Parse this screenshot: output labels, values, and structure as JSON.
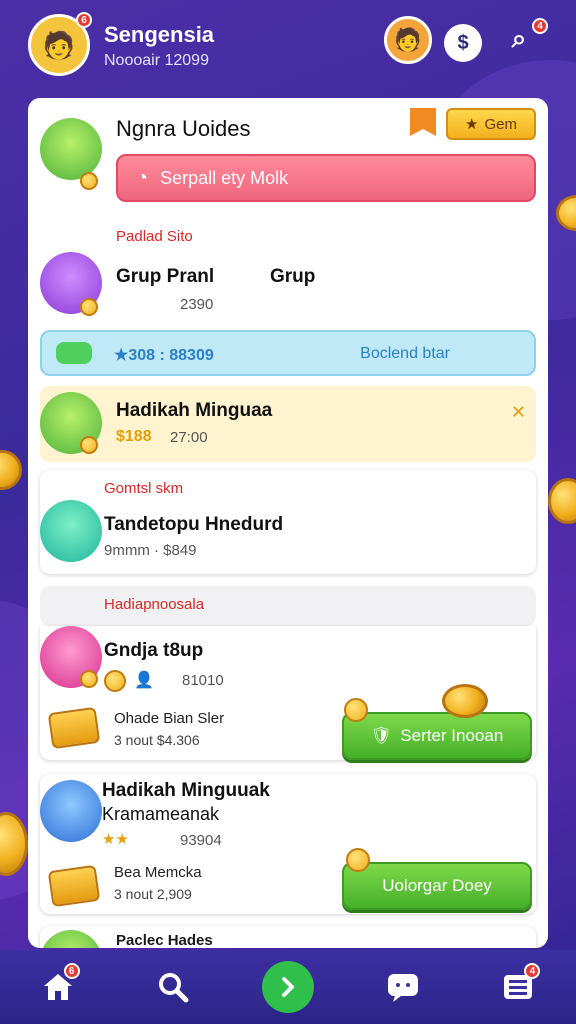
{
  "header": {
    "user_name": "Sengensia",
    "user_sub": "Noooair 12099",
    "avatar_badge": "6",
    "icons": [
      "friend-avatar-icon",
      "dollar-icon",
      "search-user-icon"
    ],
    "search_badge": "4"
  },
  "top_card": {
    "title": "Ngnra Uoides",
    "gem_label": "Gem",
    "search_text": "Serpall ety Molk"
  },
  "section1": {
    "label": "Padlad Sito",
    "title_a": "Grup Pranl",
    "title_b": "Grup",
    "sub": "2390"
  },
  "info_bar": {
    "left": "★308 : 88309",
    "right": "Boclend btar"
  },
  "highlight_row": {
    "title": "Hadikah Minguaa",
    "value": "$188",
    "sub": "27:00"
  },
  "section2": {
    "label": "Gomtsl skm",
    "title": "Tandetopu Hnedurd",
    "sub": "9mmm · $849"
  },
  "section3": {
    "label": "Hadiapnoosala",
    "title": "Gndja t8up",
    "sub": "81010",
    "item_title": "Ohade Bian Sler",
    "item_sub": "3 nout $4.306",
    "button": "Serter Inooan"
  },
  "section4": {
    "title": "Hadikah Minguuak",
    "title2": "Kramameanak",
    "sub": "93904",
    "item_title": "Bea Memcka",
    "item_sub": "3 nout 2,909",
    "button": "Uolorgar Doey"
  },
  "section5": {
    "label": "Paclec Hades"
  },
  "bottom_nav": {
    "items": [
      "home-icon",
      "search-icon",
      "play-icon",
      "chat-icon",
      "menu-icon"
    ],
    "home_badge": "6",
    "menu_badge": "4"
  }
}
